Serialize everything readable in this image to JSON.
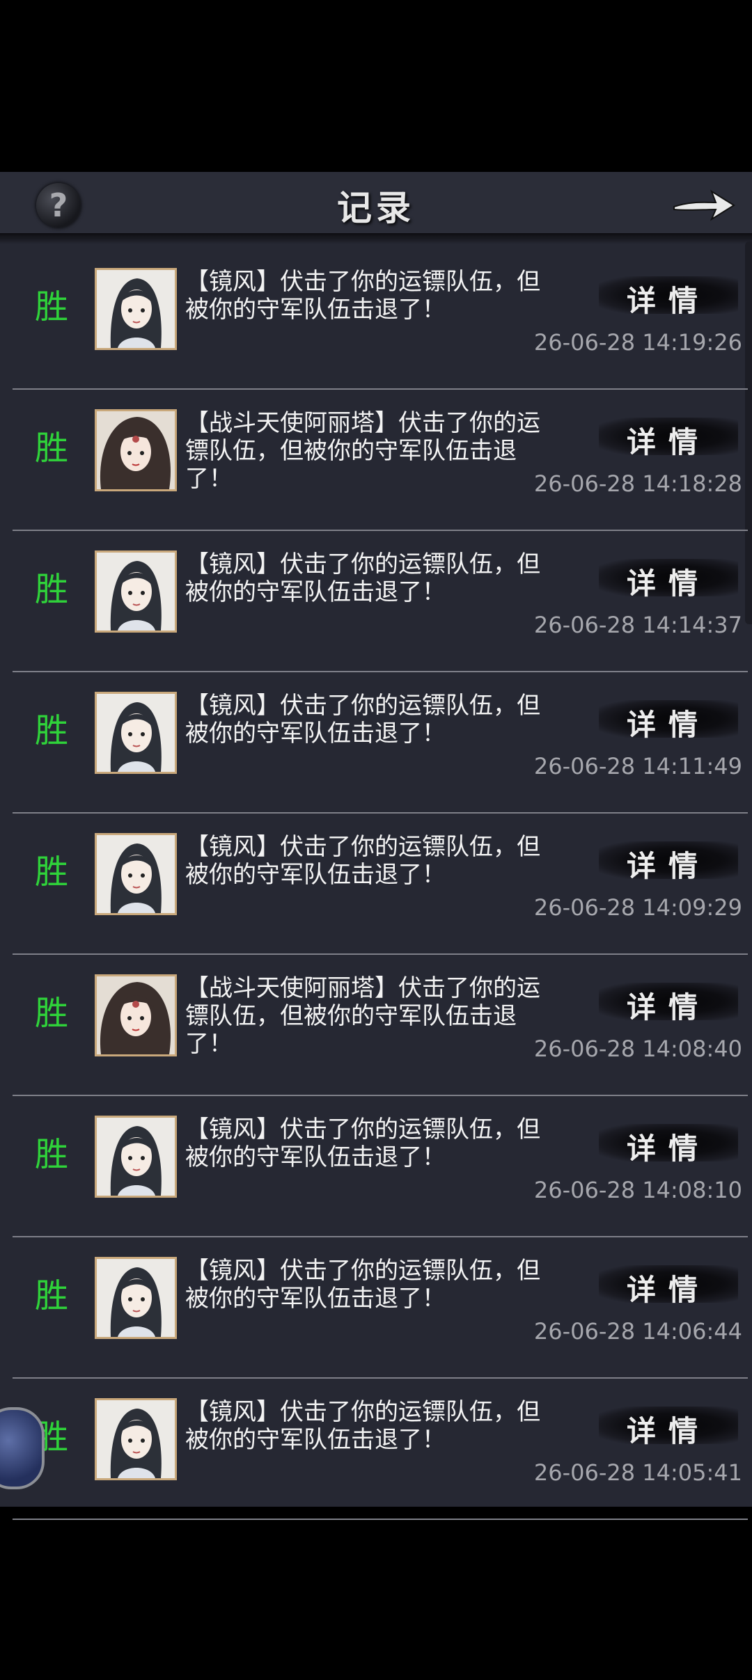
{
  "header": {
    "title": "记录",
    "help_icon": "question-mark-icon",
    "next_icon": "arrow-right-icon"
  },
  "colors": {
    "win": "#2fd33a",
    "panel": "#262833",
    "divider": "#7f8089",
    "avatar_border": "#c9a87b"
  },
  "records": [
    {
      "result": "胜",
      "avatar": "jingfeng",
      "message": "【镜风】伏击了你的运镖队伍，但被你的守军队伍击退了！",
      "detail": "详情",
      "time": "26-06-28 14:19:26"
    },
    {
      "result": "胜",
      "avatar": "alita",
      "message": "【战斗天使阿丽塔】伏击了你的运镖队伍，但被你的守军队伍击退了！",
      "detail": "详情",
      "time": "26-06-28 14:18:28"
    },
    {
      "result": "胜",
      "avatar": "jingfeng",
      "message": "【镜风】伏击了你的运镖队伍，但被你的守军队伍击退了！",
      "detail": "详情",
      "time": "26-06-28 14:14:37"
    },
    {
      "result": "胜",
      "avatar": "jingfeng",
      "message": "【镜风】伏击了你的运镖队伍，但被你的守军队伍击退了！",
      "detail": "详情",
      "time": "26-06-28 14:11:49"
    },
    {
      "result": "胜",
      "avatar": "jingfeng",
      "message": "【镜风】伏击了你的运镖队伍，但被你的守军队伍击退了！",
      "detail": "详情",
      "time": "26-06-28 14:09:29"
    },
    {
      "result": "胜",
      "avatar": "alita",
      "message": "【战斗天使阿丽塔】伏击了你的运镖队伍，但被你的守军队伍击退了！",
      "detail": "详情",
      "time": "26-06-28 14:08:40"
    },
    {
      "result": "胜",
      "avatar": "jingfeng",
      "message": "【镜风】伏击了你的运镖队伍，但被你的守军队伍击退了！",
      "detail": "详情",
      "time": "26-06-28 14:08:10"
    },
    {
      "result": "胜",
      "avatar": "jingfeng",
      "message": "【镜风】伏击了你的运镖队伍，但被你的守军队伍击退了！",
      "detail": "详情",
      "time": "26-06-28 14:06:44"
    },
    {
      "result": "胜",
      "avatar": "jingfeng",
      "message": "【镜风】伏击了你的运镖队伍，但被你的守军队伍击退了！",
      "detail": "详情",
      "time": "26-06-28 14:05:41"
    }
  ]
}
